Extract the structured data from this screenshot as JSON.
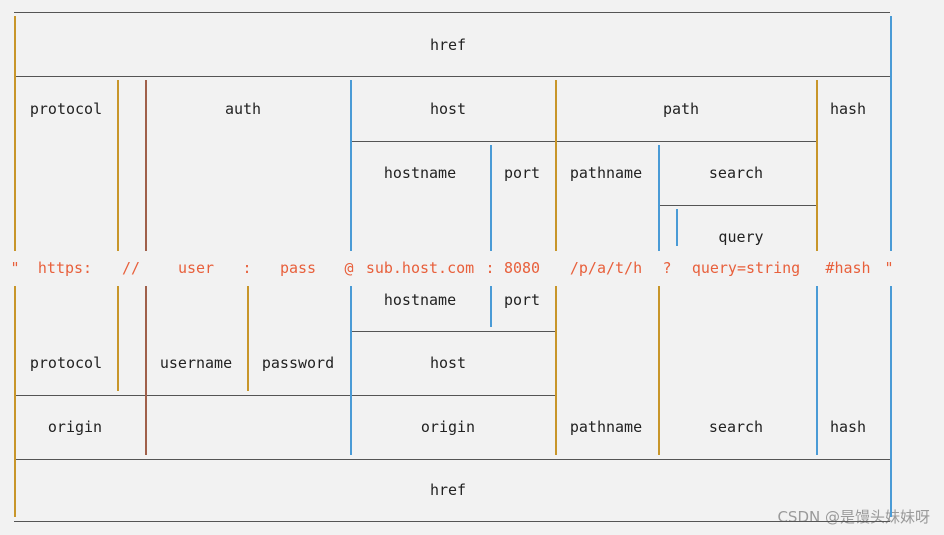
{
  "labels": {
    "href": "href",
    "protocol": "protocol",
    "auth": "auth",
    "host": "host",
    "path": "path",
    "hash": "hash",
    "hostname": "hostname",
    "port": "port",
    "pathname": "pathname",
    "search": "search",
    "query": "query",
    "username": "username",
    "password": "password",
    "origin": "origin"
  },
  "url_parts": [
    "\"",
    "https:",
    "//",
    "user",
    ":",
    "pass",
    "@",
    "sub.host.com",
    ":",
    "8080",
    "/p/a/t/h",
    "?",
    "query=string",
    "#hash",
    "\""
  ],
  "watermark": "CSDN @是馒头妹妹呀",
  "colors": {
    "text": "#222222",
    "url": "#e8603c",
    "line": "#555555",
    "bar_gold": "#c8962a",
    "bar_blue": "#4a9bd6",
    "bar_brown": "#a0604a"
  }
}
